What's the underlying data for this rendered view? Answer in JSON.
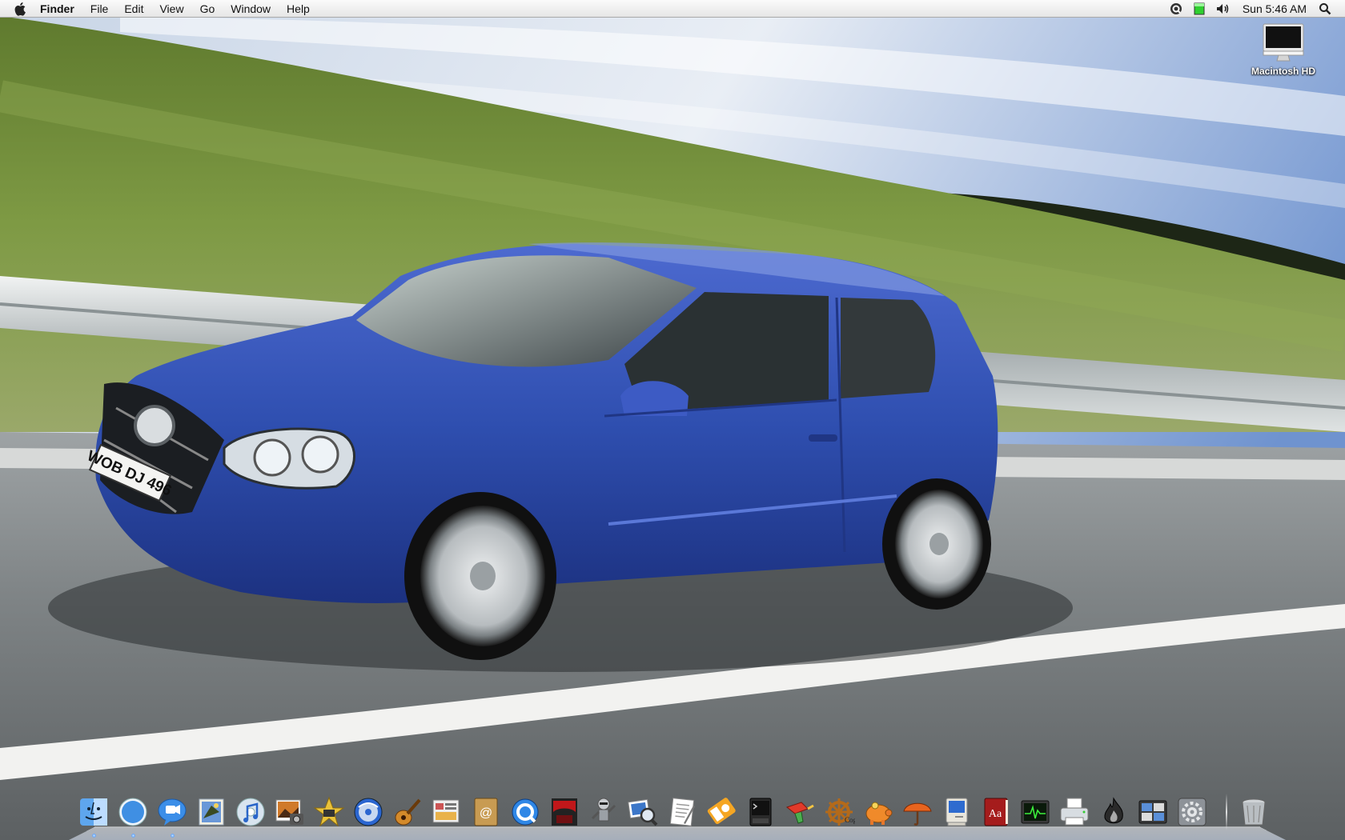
{
  "menubar": {
    "apple_icon": "apple-logo-icon",
    "menus": [
      "Finder",
      "File",
      "Edit",
      "View",
      "Go",
      "Window",
      "Help"
    ],
    "status_icons": [
      "quicksilver-icon",
      "battery-icon",
      "volume-icon"
    ],
    "clock": "Sun 5:46 AM",
    "search_icon": "spotlight-icon"
  },
  "desktop": {
    "icons": [
      {
        "label": "Macintosh HD",
        "icon": "imac-drive-icon"
      }
    ],
    "wallpaper": {
      "car_color": "#2f4fb0",
      "plate_text": "WOB DJ 496"
    }
  },
  "dock": {
    "apps": [
      {
        "icon": "finder-icon",
        "running": true
      },
      {
        "icon": "safari-icon",
        "running": true
      },
      {
        "icon": "ichat-icon",
        "running": true
      },
      {
        "icon": "mail-icon",
        "running": false
      },
      {
        "icon": "itunes-icon",
        "running": false
      },
      {
        "icon": "iphoto-icon",
        "running": false
      },
      {
        "icon": "imovie-icon",
        "running": false
      },
      {
        "icon": "idvd-icon",
        "running": false
      },
      {
        "icon": "garageband-icon",
        "running": false
      },
      {
        "icon": "iweb-icon",
        "running": false
      },
      {
        "icon": "address-book-icon",
        "running": false
      },
      {
        "icon": "quicktime-icon",
        "running": false
      },
      {
        "icon": "front-row-icon",
        "running": false
      },
      {
        "icon": "automator-icon",
        "running": false
      },
      {
        "icon": "preview-icon",
        "running": false
      },
      {
        "icon": "textedit-icon",
        "running": false
      },
      {
        "icon": "ipod-icon",
        "running": false
      },
      {
        "icon": "terminal-icon",
        "running": false
      },
      {
        "icon": "raygun-icon",
        "running": false
      },
      {
        "icon": "cog-icon",
        "running": false
      },
      {
        "icon": "piggy-bank-icon",
        "running": false
      },
      {
        "icon": "umbrella-icon",
        "running": false
      },
      {
        "icon": "classic-mac-icon",
        "running": false
      },
      {
        "icon": "dictionary-icon",
        "running": false
      },
      {
        "icon": "activity-monitor-icon",
        "running": false
      },
      {
        "icon": "printer-icon",
        "running": false
      },
      {
        "icon": "burn-icon",
        "running": false
      },
      {
        "icon": "dashboard-icon",
        "running": false
      },
      {
        "icon": "system-preferences-icon",
        "running": false
      }
    ],
    "trash": {
      "icon": "trash-icon"
    },
    "dictionary_label": "Aa"
  }
}
